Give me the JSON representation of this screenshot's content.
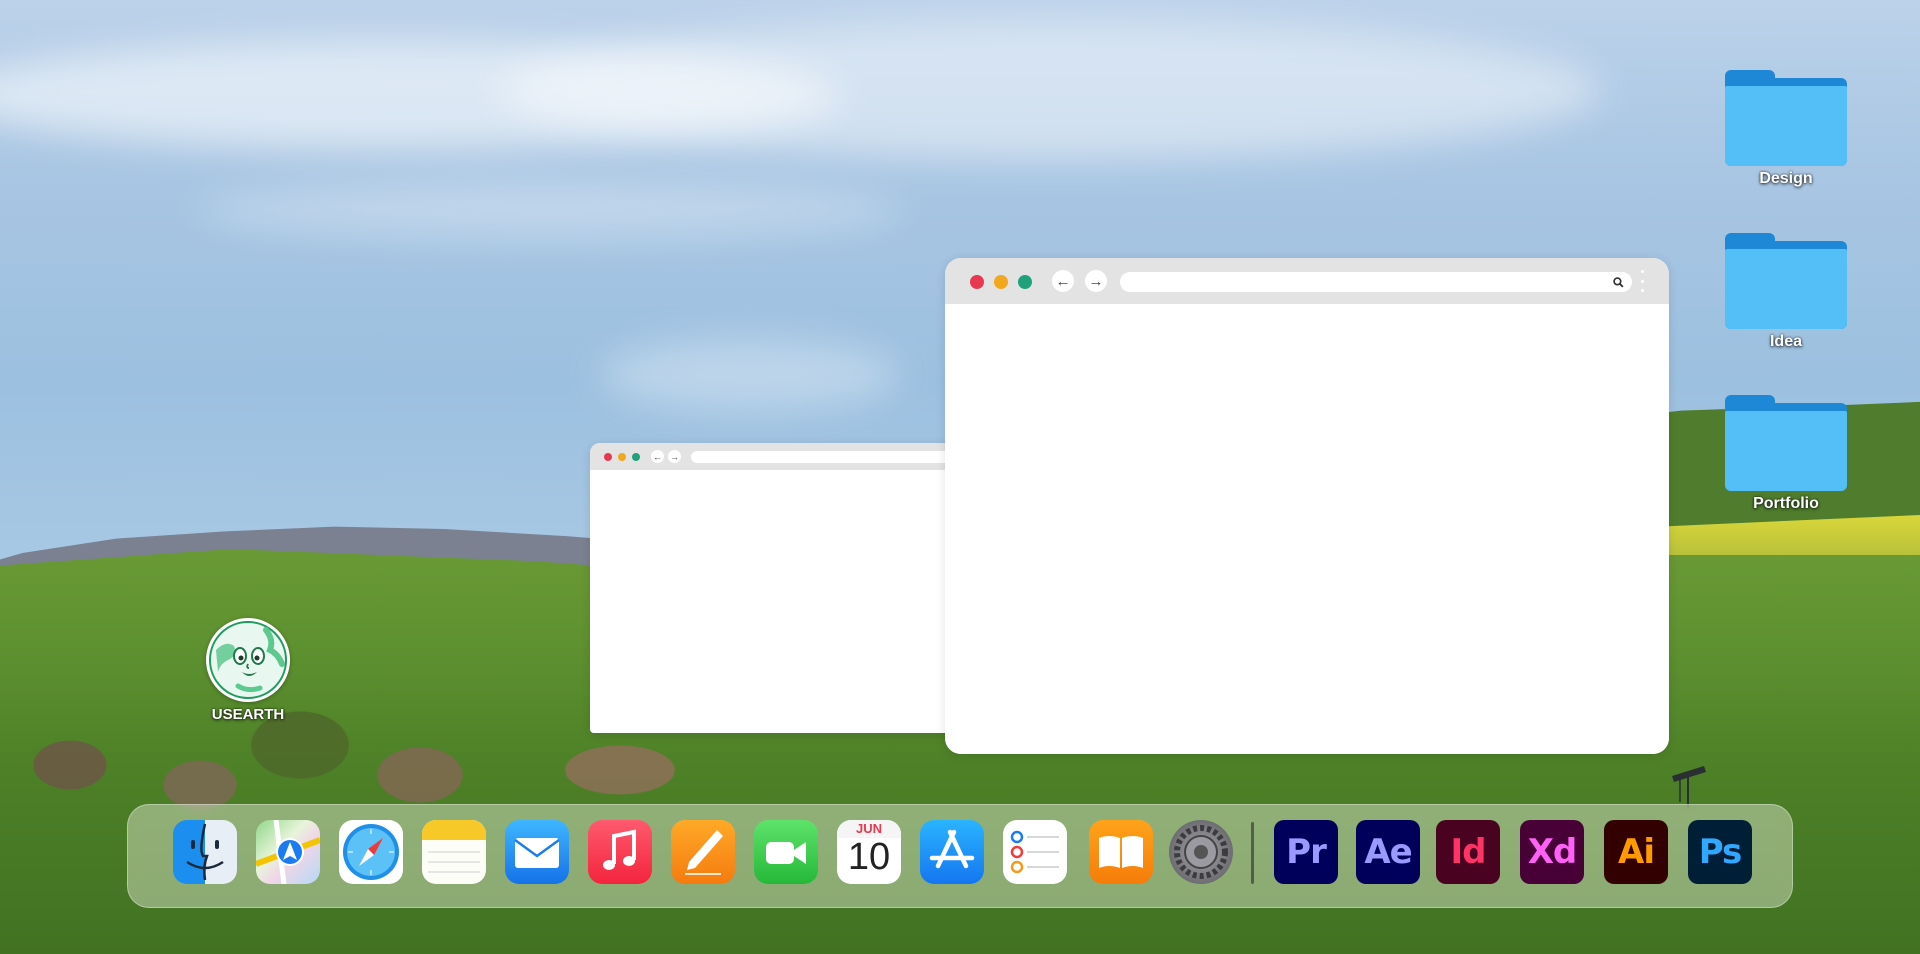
{
  "desktop": {
    "folders": [
      {
        "label": "Design"
      },
      {
        "label": "Idea"
      },
      {
        "label": "Portfolio"
      }
    ],
    "app_shortcut": {
      "label": "USEARTH"
    }
  },
  "windows": {
    "large": {
      "title": "",
      "url": ""
    },
    "small": {
      "title": "",
      "url": ""
    }
  },
  "dock": {
    "apps": [
      {
        "name": "Finder",
        "icon": "finder-icon"
      },
      {
        "name": "Maps",
        "icon": "maps-icon"
      },
      {
        "name": "Safari",
        "icon": "safari-icon"
      },
      {
        "name": "Notes",
        "icon": "notes-icon"
      },
      {
        "name": "Mail",
        "icon": "mail-icon"
      },
      {
        "name": "Music",
        "icon": "music-icon"
      },
      {
        "name": "Pages",
        "icon": "pages-icon"
      },
      {
        "name": "FaceTime",
        "icon": "facetime-icon"
      },
      {
        "name": "Calendar",
        "icon": "calendar-icon",
        "month": "JUN",
        "day": "10"
      },
      {
        "name": "App Store",
        "icon": "app-store-icon"
      },
      {
        "name": "Reminders",
        "icon": "reminders-icon"
      },
      {
        "name": "Books",
        "icon": "books-icon"
      },
      {
        "name": "System Preferences",
        "icon": "settings-gear-icon"
      }
    ],
    "adobe_apps": [
      {
        "abbr": "Pr",
        "name": "Premiere Pro",
        "bg": "#00005b",
        "fg": "#9999ff"
      },
      {
        "abbr": "Ae",
        "name": "After Effects",
        "bg": "#00005b",
        "fg": "#9999ff"
      },
      {
        "abbr": "Id",
        "name": "InDesign",
        "bg": "#49021f",
        "fg": "#ff3366"
      },
      {
        "abbr": "Xd",
        "name": "XD",
        "bg": "#470137",
        "fg": "#ff61f6"
      },
      {
        "abbr": "Ai",
        "name": "Illustrator",
        "bg": "#330000",
        "fg": "#ff9a00"
      },
      {
        "abbr": "Ps",
        "name": "Photoshop",
        "bg": "#001e36",
        "fg": "#31a8ff"
      }
    ]
  },
  "colors": {
    "folder_front": "#53bff6",
    "folder_back": "#1e88d6",
    "traffic_red": "#e8384f",
    "traffic_yellow": "#f2a81d",
    "traffic_green": "#1fa27a",
    "titlebar": "#e3e3e3"
  }
}
